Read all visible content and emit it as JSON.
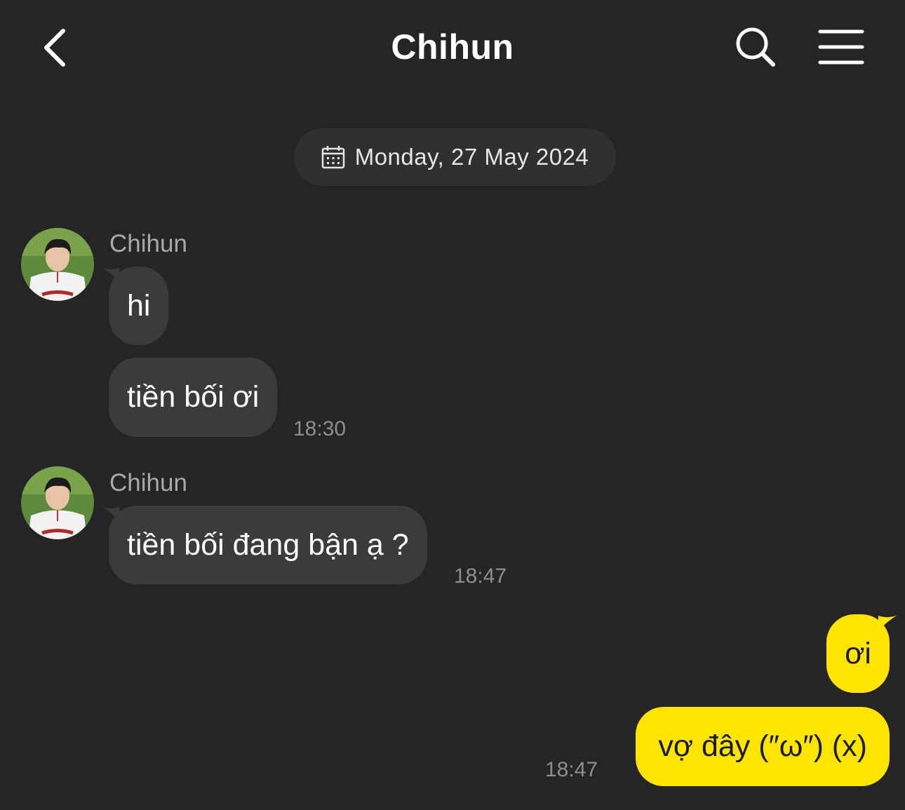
{
  "header": {
    "title": "Chihun",
    "back_icon": "chevron-left-icon",
    "search_icon": "search-icon",
    "menu_icon": "hamburger-menu-icon"
  },
  "date_separator": {
    "icon": "calendar-icon",
    "text": "Monday, 27 May 2024"
  },
  "messages": [
    {
      "sender": "Chihun",
      "bubbles": [
        "hi",
        "tiền bối ơi"
      ],
      "time": "18:30"
    },
    {
      "sender": "Chihun",
      "bubbles": [
        "tiền bối đang bận ạ ?"
      ],
      "time": "18:47"
    },
    {
      "sender": "me",
      "bubbles": [
        "ơi",
        "vợ đây (″ω″) (x)"
      ],
      "time": "18:47"
    }
  ],
  "colors": {
    "background": "#252527",
    "incoming_bubble": "#3b3b3d",
    "outgoing_bubble": "#fee500",
    "timestamp": "#8e8e90",
    "sender_name": "#a9a9ab"
  }
}
